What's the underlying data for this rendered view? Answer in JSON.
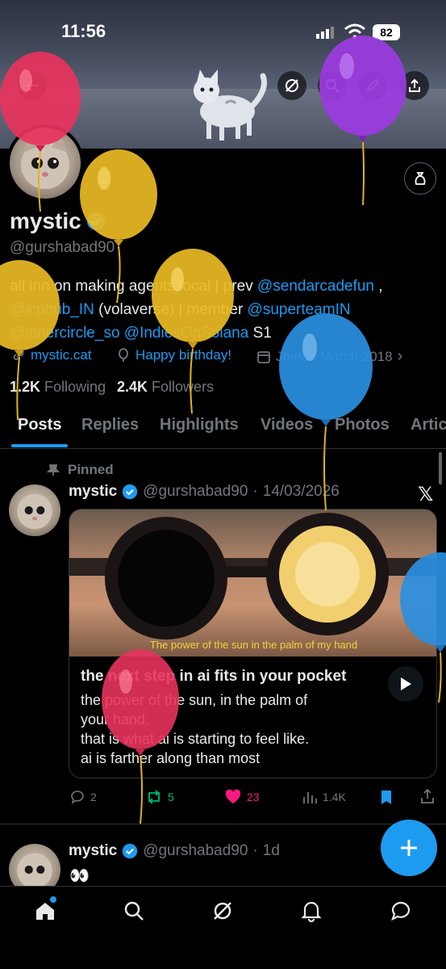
{
  "status_bar": {
    "time": "11:56",
    "battery": "82"
  },
  "profile": {
    "name": "mystic",
    "handle": "@gurshabad90",
    "bio": {
      "line1_prefix": "all inn on making agents local | prev ",
      "line1_link": "@sendarcadefun",
      "line1_suffix": " ,",
      "line2_link1": "@icphub_IN",
      "line2_mid": " (volaverse) | member ",
      "line2_link2": "@superteamIN",
      "line3_link1": "@innercircle_so",
      "line3_link2": "@IndiesOnSolana",
      "line3_suffix": " S1"
    },
    "website": "mystic.cat",
    "birthday": "Happy birthday!",
    "joined": "Joined March 2018",
    "following_count": "1.2K",
    "following_label": "Following",
    "followers_count": "2.4K",
    "followers_label": "Followers"
  },
  "tabs": [
    "Posts",
    "Replies",
    "Highlights",
    "Videos",
    "Photos",
    "Artic"
  ],
  "pinned_post": {
    "pinned_label": "Pinned",
    "name": "mystic",
    "handle": "@gurshabad90",
    "date": "14/03/2026",
    "video_caption": "The power of the sun in the palm of my hand",
    "title": "the next step in ai fits in your pocket",
    "body_line1": "the power of the sun, in the palm of",
    "body_line2": "your hand.",
    "body_line3": "that is what ai is starting to feel like.",
    "body_line4": "ai is farther along than most",
    "replies": "2",
    "reposts": "5",
    "likes": "23",
    "views": "1.4K"
  },
  "second_post": {
    "name": "mystic",
    "handle": "@gurshabad90",
    "time": "1d",
    "text": "👀"
  },
  "colors": {
    "accent": "#1d9bf0",
    "like": "#f91880",
    "repost": "#00ba7c",
    "balloon_red": "#e8335d",
    "balloon_yellow": "#e8b923",
    "balloon_purple": "#9b3be0",
    "balloon_blue": "#2a8fe0"
  }
}
